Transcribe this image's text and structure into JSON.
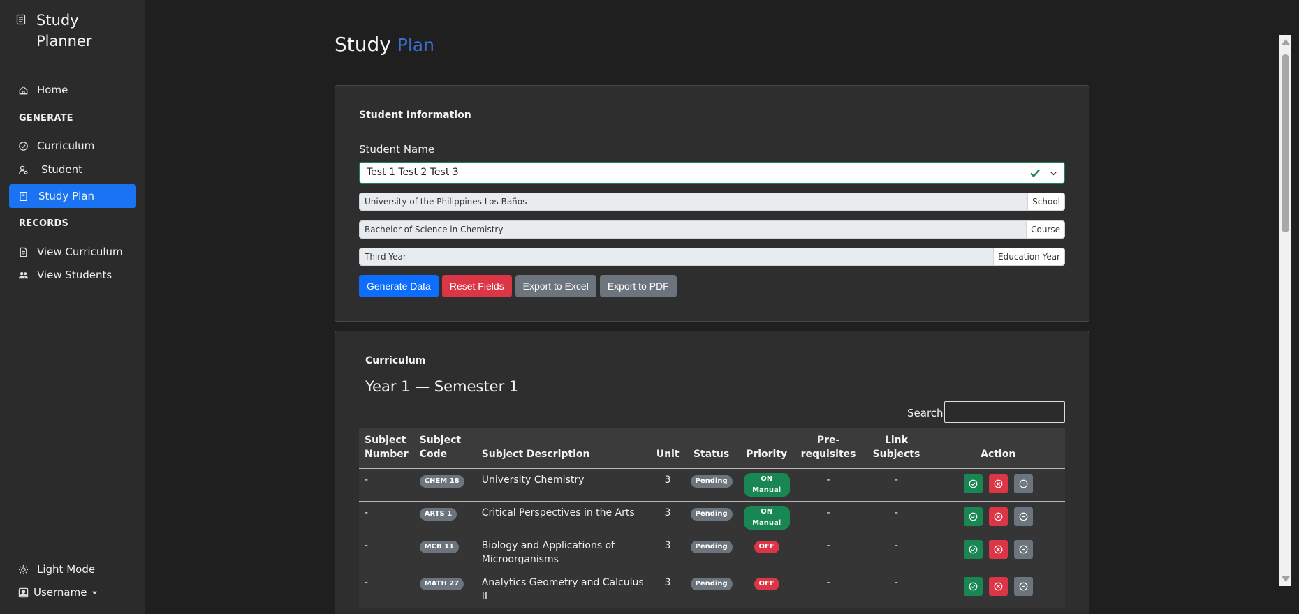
{
  "sidebar": {
    "brand": "Study Planner",
    "home": "Home",
    "generate_heading": "GENERATE",
    "curriculum": "Curriculum",
    "student": "Student",
    "study_plan": "Study Plan",
    "records_heading": "RECORDS",
    "view_curriculum": "View Curriculum",
    "view_students": "View Students",
    "theme_toggle": "Light Mode",
    "user": "Username"
  },
  "page": {
    "title": "Study",
    "title_accent": "Plan"
  },
  "student_info": {
    "title": "Student Information",
    "name_label": "Student Name",
    "name_value": "Test 1 Test 2 Test 3",
    "school_value": "University of the Philippines Los Baños",
    "school_addon": "School",
    "course_value": "Bachelor of Science in Chemistry",
    "course_addon": "Course",
    "year_value": "Third Year",
    "year_addon": "Education Year",
    "buttons": {
      "generate": "Generate Data",
      "reset": "Reset Fields",
      "excel": "Export to Excel",
      "pdf": "Export to PDF"
    }
  },
  "curriculum": {
    "title": "Curriculum",
    "term": "Year 1 — Semester 1",
    "search_label": "Search:",
    "search_value": "",
    "headers": {
      "number": "Subject Number",
      "code": "Subject Code",
      "description": "Subject Description",
      "unit": "Unit",
      "status": "Status",
      "priority": "Priority",
      "prereq": "Pre-requisites",
      "link": "Link Subjects",
      "action": "Action"
    },
    "rows": [
      {
        "number": "-",
        "code": "CHEM 18",
        "description": "University Chemistry",
        "unit": "3",
        "status": "Pending",
        "priority": "ON Manual",
        "prereq": "-",
        "link": "-"
      },
      {
        "number": "-",
        "code": "ARTS 1",
        "description": "Critical Perspectives in the Arts",
        "unit": "3",
        "status": "Pending",
        "priority": "ON Manual",
        "prereq": "-",
        "link": "-"
      },
      {
        "number": "-",
        "code": "MCB 11",
        "description": "Biology and Applications of Microorganisms",
        "unit": "3",
        "status": "Pending",
        "priority": "OFF",
        "prereq": "-",
        "link": "-"
      },
      {
        "number": "-",
        "code": "MATH 27",
        "description": "Analytics Geometry and Calculus II",
        "unit": "3",
        "status": "Pending",
        "priority": "OFF",
        "prereq": "-",
        "link": "-"
      }
    ]
  },
  "colors": {
    "accent": "#1a73f2",
    "success": "#198754",
    "danger": "#dc3545",
    "secondary": "#6c757d"
  }
}
